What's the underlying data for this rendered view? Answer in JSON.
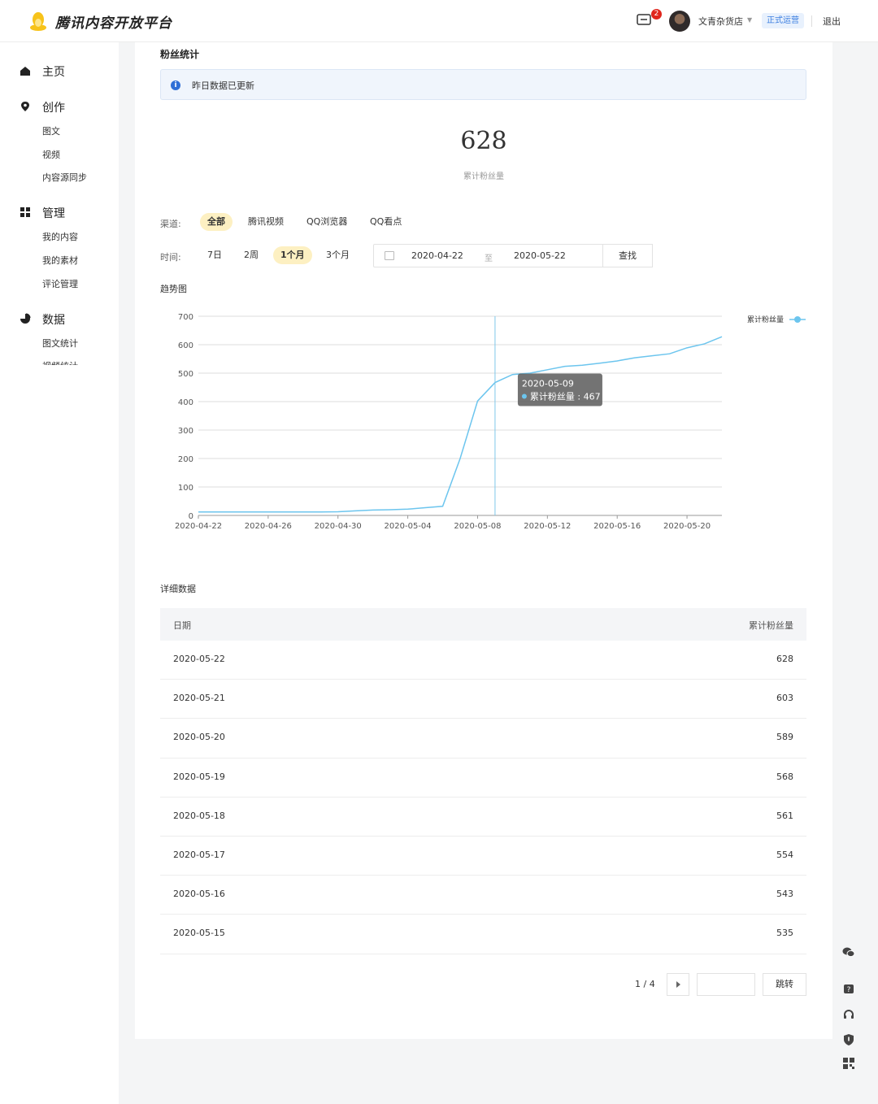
{
  "header": {
    "brand": "腾讯内容开放平台",
    "mail_count": "2",
    "user_name": "文青杂货店",
    "status": "正式运营",
    "logout": "退出"
  },
  "sidebar": {
    "groups": [
      {
        "label": "主页",
        "icon": "home-icon",
        "items": []
      },
      {
        "label": "创作",
        "icon": "location-pin-icon",
        "items": [
          "图文",
          "视频",
          "内容源同步"
        ]
      },
      {
        "label": "管理",
        "icon": "grid-icon",
        "items": [
          "我的内容",
          "我的素材",
          "评论管理"
        ]
      },
      {
        "label": "数据",
        "icon": "pie-chart-icon",
        "items": [
          "图文统计",
          "视频统计"
        ]
      }
    ]
  },
  "main": {
    "section_title": "粉丝统计",
    "notice": "昨日数据已更新",
    "total_fans": "628",
    "total_fans_label": "累计粉丝量",
    "channel_label": "渠道:",
    "channels": [
      "全部",
      "腾讯视频",
      "QQ浏览器",
      "QQ看点"
    ],
    "channel_active": 0,
    "time_label": "时间:",
    "ranges": [
      "7日",
      "2周",
      "1个月",
      "3个月"
    ],
    "range_active": 2,
    "date_from": "2020-04-22",
    "date_sep": "至",
    "date_to": "2020-05-22",
    "search_button": "查找",
    "trend_title": "趋势图",
    "detail_title": "详细数据"
  },
  "chart_data": {
    "type": "line",
    "title": "",
    "xlabel": "",
    "ylabel": "",
    "ylim": [
      0,
      700
    ],
    "yticks": [
      0,
      100,
      200,
      300,
      400,
      500,
      600,
      700
    ],
    "xticks": [
      "2020-04-22",
      "2020-04-26",
      "2020-04-30",
      "2020-05-04",
      "2020-05-08",
      "2020-05-12",
      "2020-05-16",
      "2020-05-20"
    ],
    "x": [
      "2020-04-22",
      "2020-04-23",
      "2020-04-24",
      "2020-04-25",
      "2020-04-26",
      "2020-04-27",
      "2020-04-28",
      "2020-04-29",
      "2020-04-30",
      "2020-05-01",
      "2020-05-02",
      "2020-05-03",
      "2020-05-04",
      "2020-05-05",
      "2020-05-06",
      "2020-05-07",
      "2020-05-08",
      "2020-05-09",
      "2020-05-10",
      "2020-05-11",
      "2020-05-12",
      "2020-05-13",
      "2020-05-14",
      "2020-05-15",
      "2020-05-16",
      "2020-05-17",
      "2020-05-18",
      "2020-05-19",
      "2020-05-20",
      "2020-05-21",
      "2020-05-22"
    ],
    "series": [
      {
        "name": "累计粉丝量",
        "color": "#6cc5ee",
        "values": [
          12,
          12,
          12,
          12,
          12,
          12,
          12,
          12,
          13,
          16,
          19,
          20,
          22,
          27,
          32,
          200,
          402,
          467,
          495,
          500,
          512,
          524,
          528,
          535,
          543,
          554,
          561,
          568,
          589,
          603,
          628
        ]
      }
    ],
    "legend": "top-right",
    "grid": true,
    "tooltip": {
      "date": "2020-05-09",
      "label": "累计粉丝量",
      "value": "467",
      "index": 17
    }
  },
  "table": {
    "headers": [
      "日期",
      "累计粉丝量"
    ],
    "rows": [
      [
        "2020-05-22",
        "628"
      ],
      [
        "2020-05-21",
        "603"
      ],
      [
        "2020-05-20",
        "589"
      ],
      [
        "2020-05-19",
        "568"
      ],
      [
        "2020-05-18",
        "561"
      ],
      [
        "2020-05-17",
        "554"
      ],
      [
        "2020-05-16",
        "543"
      ],
      [
        "2020-05-15",
        "535"
      ]
    ]
  },
  "pagination": {
    "page": "1 / 4",
    "jump": "跳转"
  },
  "tools": [
    "wechat-icon",
    "help-icon",
    "headset-icon",
    "shield-icon",
    "qrcode-icon"
  ],
  "colors": {
    "accent": "#fdf0c2",
    "line": "#6cc5ee",
    "info": "#2f6fd6",
    "badge": "#e0261c"
  }
}
